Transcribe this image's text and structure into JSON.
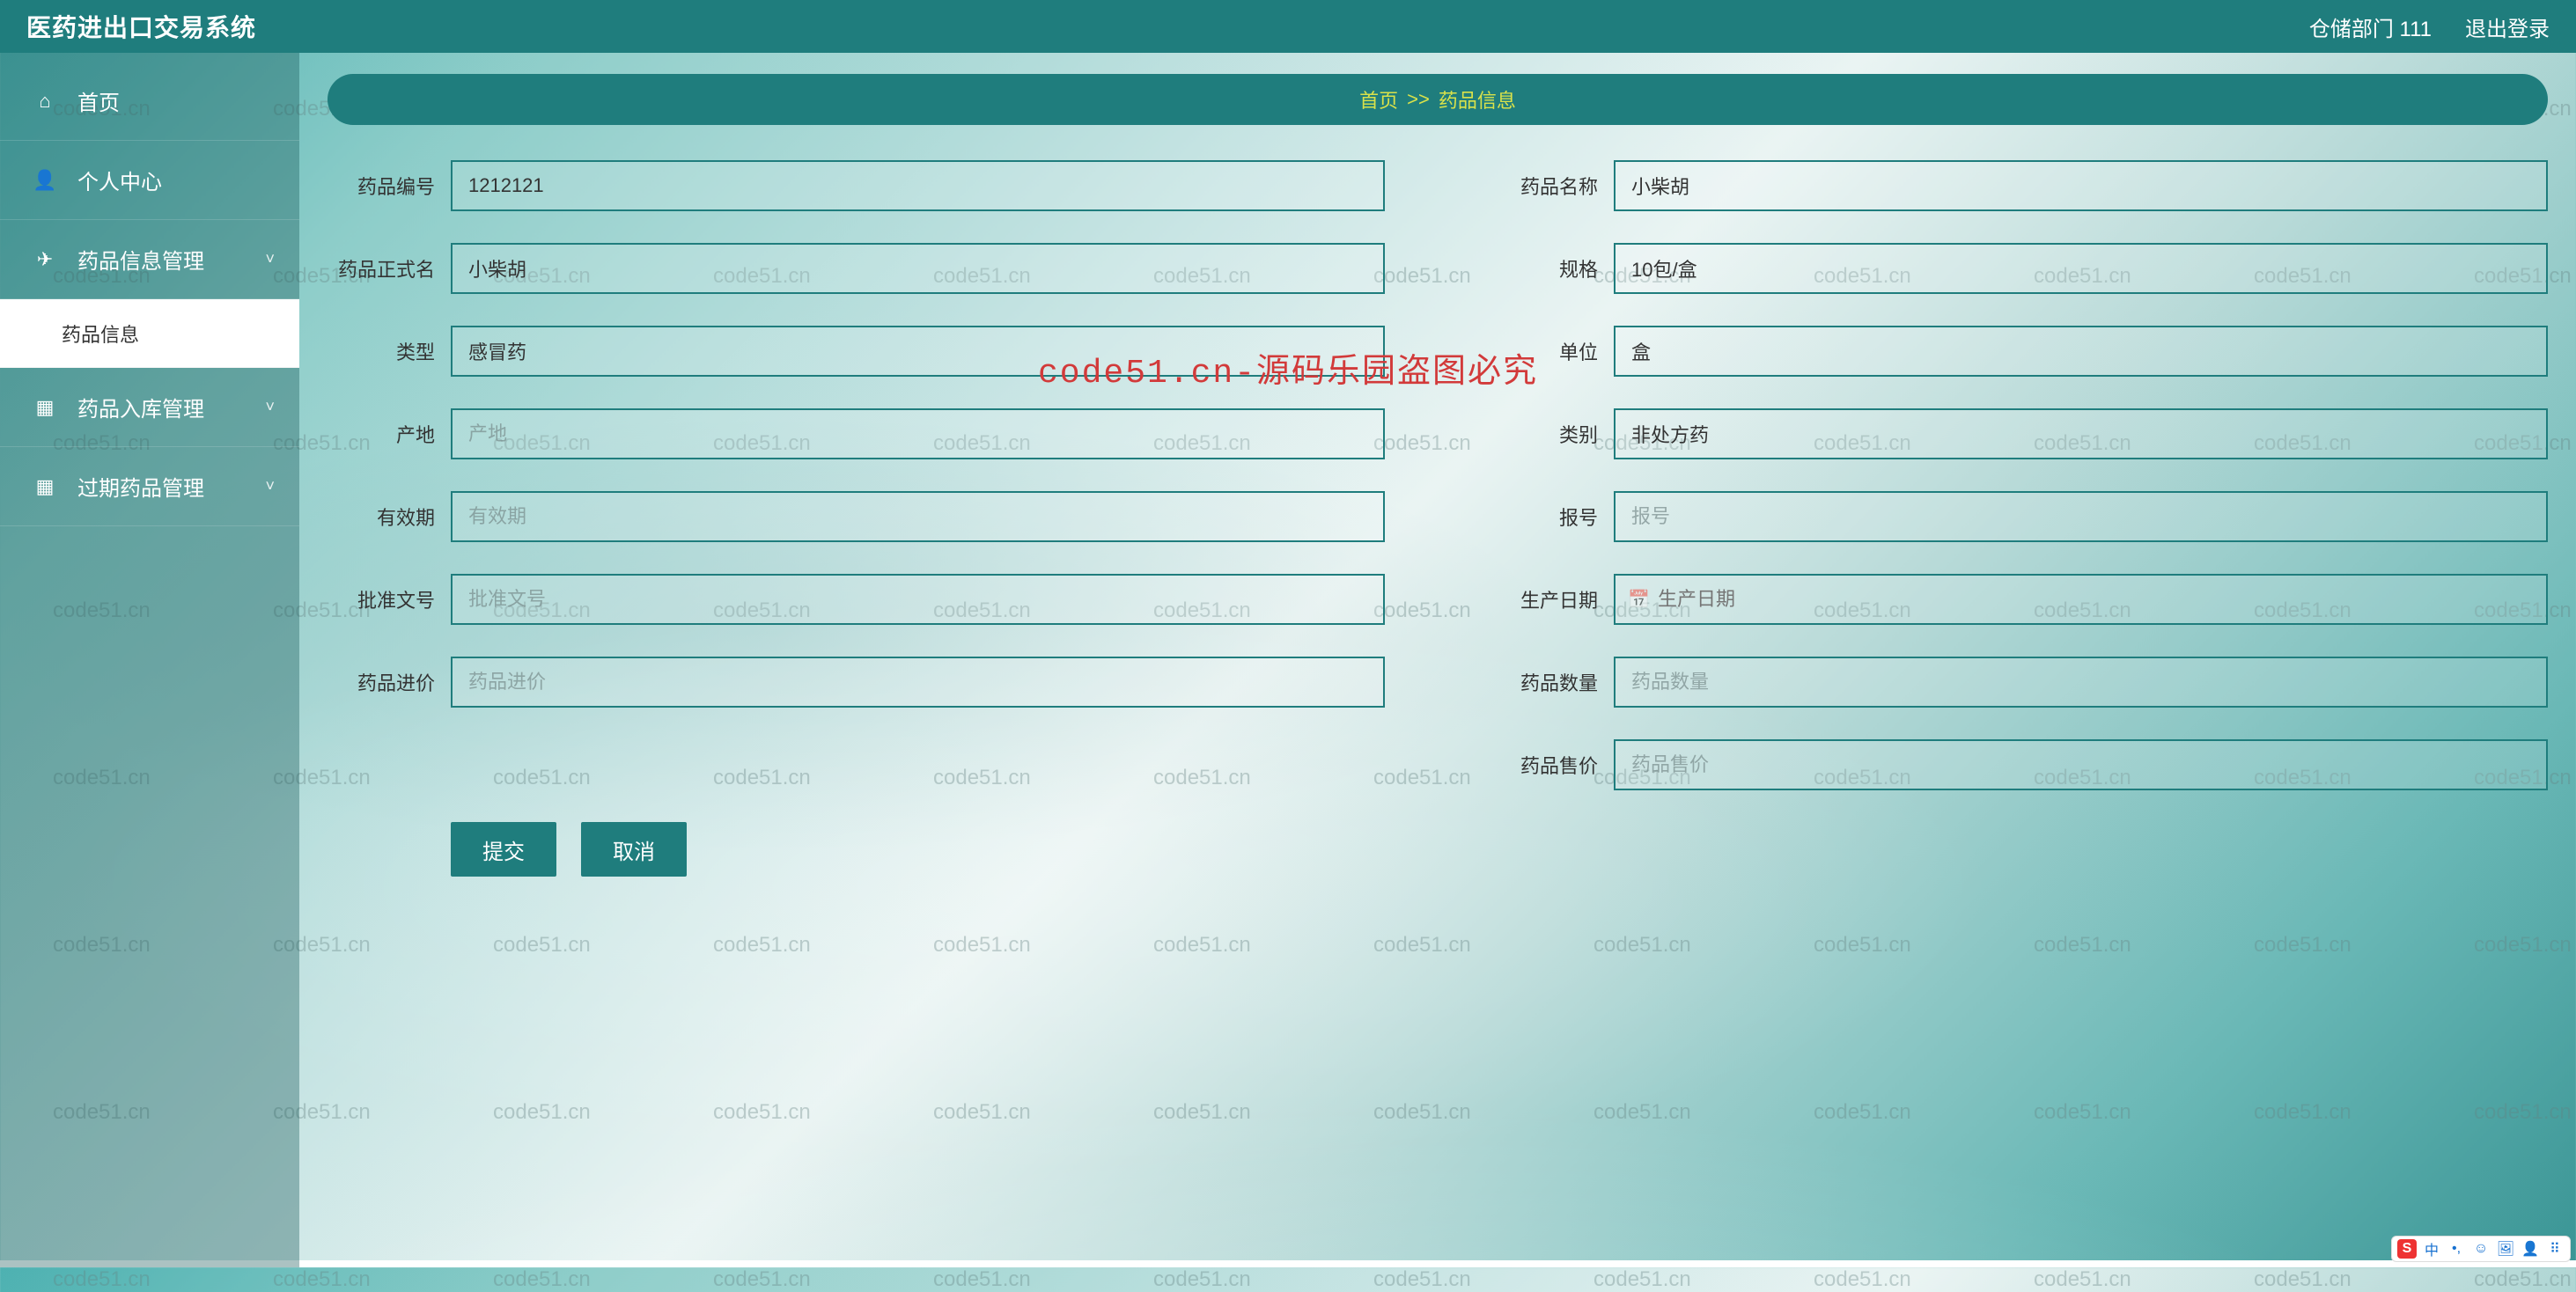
{
  "topbar": {
    "title": "医药进出口交易系统",
    "user": "仓储部门 111",
    "logout": "退出登录"
  },
  "sidebar": {
    "items": [
      {
        "icon": "home",
        "label": "首页",
        "expandable": false
      },
      {
        "icon": "user",
        "label": "个人中心",
        "expandable": false
      },
      {
        "icon": "send",
        "label": "药品信息管理",
        "expandable": true,
        "expanded": true,
        "children": [
          {
            "label": "药品信息",
            "active": true
          }
        ]
      },
      {
        "icon": "grid",
        "label": "药品入库管理",
        "expandable": true
      },
      {
        "icon": "grid",
        "label": "过期药品管理",
        "expandable": true
      }
    ]
  },
  "breadcrumb": {
    "home": "首页",
    "sep": ">>",
    "current": "药品信息"
  },
  "form": {
    "left": [
      {
        "key": "code",
        "label": "药品编号",
        "value": "1212121",
        "placeholder": ""
      },
      {
        "key": "fullname",
        "label": "药品正式名",
        "value": "小柴胡",
        "placeholder": ""
      },
      {
        "key": "type",
        "label": "类型",
        "value": "感冒药",
        "placeholder": ""
      },
      {
        "key": "origin",
        "label": "产地",
        "value": "",
        "placeholder": "产地"
      },
      {
        "key": "expiry",
        "label": "有效期",
        "value": "",
        "placeholder": "有效期"
      },
      {
        "key": "approval",
        "label": "批准文号",
        "value": "",
        "placeholder": "批准文号"
      },
      {
        "key": "inprice",
        "label": "药品进价",
        "value": "",
        "placeholder": "药品进价"
      }
    ],
    "right": [
      {
        "key": "name",
        "label": "药品名称",
        "value": "小柴胡",
        "placeholder": ""
      },
      {
        "key": "spec",
        "label": "规格",
        "value": "10包/盒",
        "placeholder": ""
      },
      {
        "key": "unit",
        "label": "单位",
        "value": "盒",
        "placeholder": ""
      },
      {
        "key": "cat",
        "label": "类别",
        "value": "非处方药",
        "placeholder": ""
      },
      {
        "key": "report",
        "label": "报号",
        "value": "",
        "placeholder": "报号"
      },
      {
        "key": "proddate",
        "label": "生产日期",
        "value": "",
        "placeholder": "生产日期",
        "date": true
      },
      {
        "key": "qty",
        "label": "药品数量",
        "value": "",
        "placeholder": "药品数量"
      },
      {
        "key": "outprice",
        "label": "药品售价",
        "value": "",
        "placeholder": "药品售价"
      }
    ],
    "submit": "提交",
    "cancel": "取消"
  },
  "watermark": {
    "text": "code51.cn",
    "center": "code51.cn-源码乐园盗图必究"
  },
  "colors": {
    "primary": "#1f7d7d",
    "accentText": "#d9e24a",
    "danger": "#d23a3a"
  },
  "ime": {
    "logo": "S",
    "items": [
      "中",
      "•,",
      "☺",
      "🖼",
      "👤",
      "⠿"
    ]
  }
}
